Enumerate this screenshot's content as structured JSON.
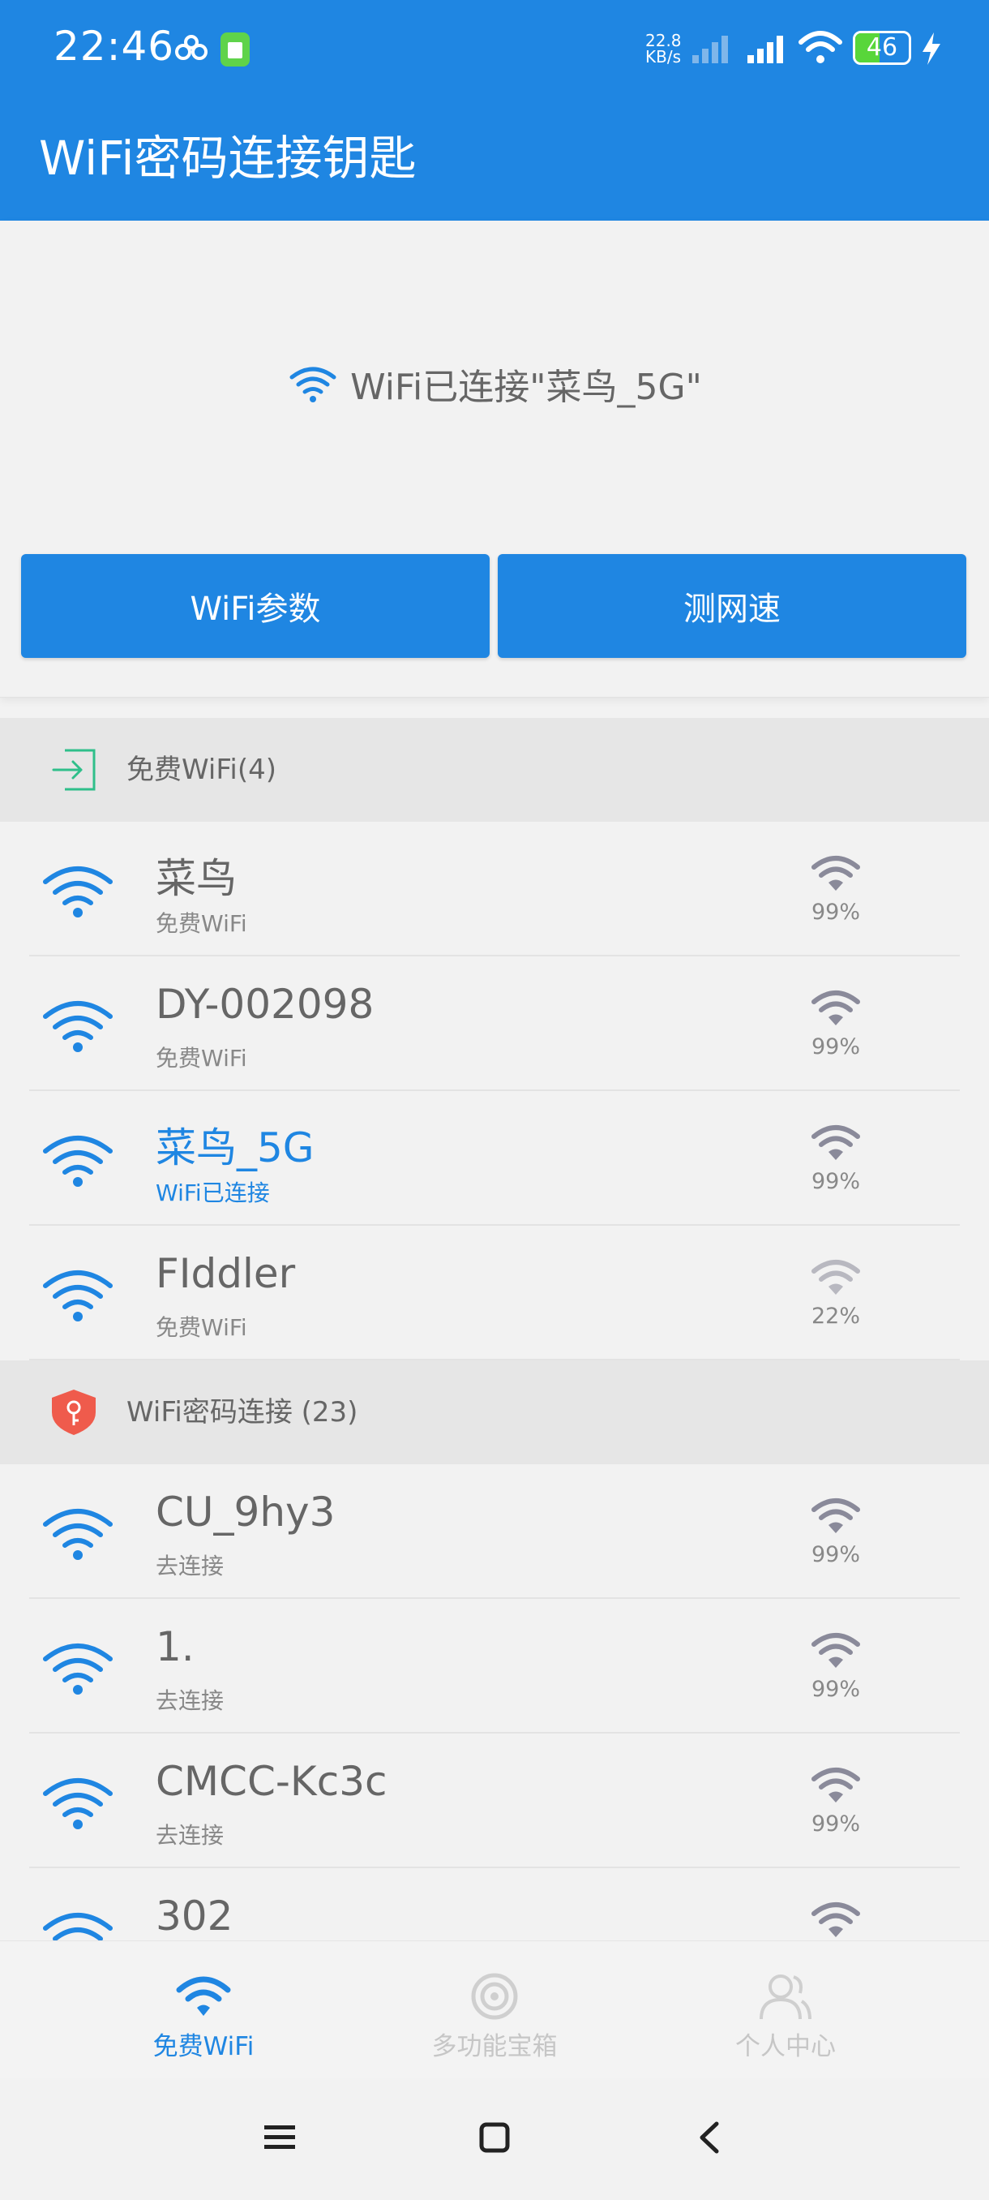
{
  "status_bar": {
    "time": "22:46",
    "net_speed_value": "22.8",
    "net_speed_unit": "KB/s",
    "battery": "46",
    "battery_level": 0.46
  },
  "app_title": "WiFi密码连接钥匙",
  "connection": {
    "status_text": "WiFi已连接\"菜鸟_5G\"",
    "btn_params": "WiFi参数",
    "btn_speed": "测网速"
  },
  "free_section": {
    "title": "免费WiFi(4)",
    "items": [
      {
        "name": "菜鸟",
        "sub": "免费WiFi",
        "signal": "99%",
        "active": false
      },
      {
        "name": "DY-002098",
        "sub": "免费WiFi",
        "signal": "99%",
        "active": false
      },
      {
        "name": "菜鸟_5G",
        "sub": "WiFi已连接",
        "signal": "99%",
        "active": true
      },
      {
        "name": "FIddler",
        "sub": "免费WiFi",
        "signal": "22%",
        "active": false
      }
    ]
  },
  "password_section": {
    "title": "WiFi密码连接 (23)",
    "items": [
      {
        "name": "CU_9hy3",
        "sub": "去连接",
        "signal": "99%"
      },
      {
        "name": "1.",
        "sub": "去连接",
        "signal": "99%"
      },
      {
        "name": "CMCC-Kc3c",
        "sub": "去连接",
        "signal": "99%"
      },
      {
        "name": "302",
        "sub": "",
        "signal": ""
      }
    ]
  },
  "bottom_nav": [
    {
      "label": "免费WiFi",
      "icon": "wifi-icon",
      "active": true
    },
    {
      "label": "多功能宝箱",
      "icon": "radar-icon",
      "active": false
    },
    {
      "label": "个人中心",
      "icon": "users-icon",
      "active": false
    }
  ],
  "colors": {
    "accent": "#1f86e2",
    "signal_gray": "#8a8a9a",
    "header_red": "#ef5b4c",
    "header_green": "#2fbf8a"
  }
}
